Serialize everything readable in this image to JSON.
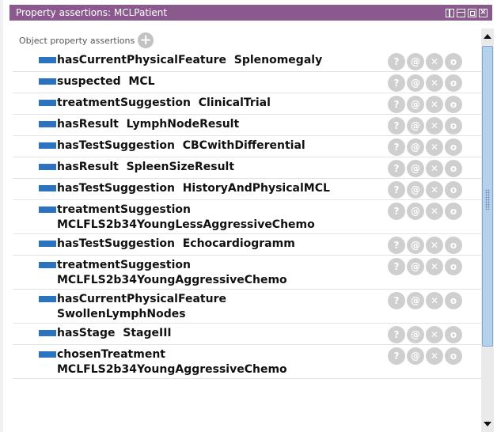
{
  "window": {
    "title": "Property assertions: MCLPatient",
    "colors": {
      "titlebar": "#8a5a8e",
      "chip": "#2b73c0",
      "action_button": "#cfcfcf"
    }
  },
  "section": {
    "header": "Object property assertions",
    "add_icon": "plus-circle-icon"
  },
  "rows": [
    {
      "property": "hasCurrentPhysicalFeature",
      "value": "Splenomegaly",
      "layout": "single"
    },
    {
      "property": "suspected",
      "value": "MCL",
      "layout": "single"
    },
    {
      "property": "treatmentSuggestion",
      "value": "ClinicalTrial",
      "layout": "single"
    },
    {
      "property": "hasResult",
      "value": "LymphNodeResult",
      "layout": "single"
    },
    {
      "property": "hasTestSuggestion",
      "value": "CBCwithDifferential",
      "layout": "single"
    },
    {
      "property": "hasResult",
      "value": "SpleenSizeResult",
      "layout": "single"
    },
    {
      "property": "hasTestSuggestion",
      "value": "HistoryAndPhysicalMCL",
      "layout": "single"
    },
    {
      "property": "treatmentSuggestion",
      "value": "MCLFLS2b34YoungLessAggressiveChemo",
      "layout": "double"
    },
    {
      "property": "hasTestSuggestion",
      "value": "Echocardiogramm",
      "layout": "single"
    },
    {
      "property": "treatmentSuggestion",
      "value": "MCLFLS2b34YoungAggressiveChemo",
      "layout": "double"
    },
    {
      "property": "hasCurrentPhysicalFeature",
      "value": "SwollenLymphNodes",
      "layout": "double"
    },
    {
      "property": "hasStage",
      "value": "StageIII",
      "layout": "single"
    },
    {
      "property": "chosenTreatment",
      "value": "MCLFLS2b34YoungAggressiveChemo",
      "layout": "double"
    }
  ],
  "row_actions": [
    {
      "icon": "question-icon",
      "glyph": "?"
    },
    {
      "icon": "annotation-icon",
      "glyph": "@"
    },
    {
      "icon": "delete-icon",
      "glyph": "✕"
    },
    {
      "icon": "edit-icon",
      "glyph": "o"
    }
  ]
}
